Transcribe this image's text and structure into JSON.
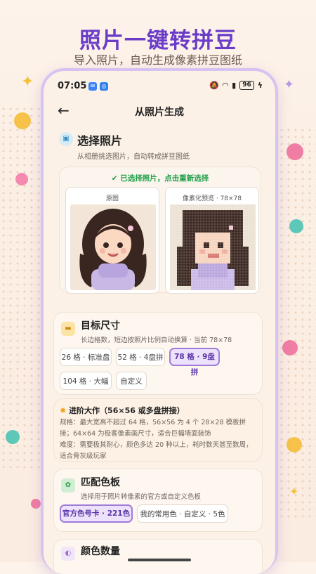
{
  "promo": {
    "title": "照片一键转拼豆",
    "subtitle": "导入照片，自动生成像素拼豆图纸"
  },
  "status_bar": {
    "time": "07:05",
    "battery": "96"
  },
  "nav": {
    "title": "从照片生成"
  },
  "select_photo": {
    "title": "选择照片",
    "desc": "从相册挑选图片，自动转成拼豆图纸",
    "selected_notice": "已选择照片，点击重新选择",
    "original_caption": "原图",
    "preview_caption": "像素化预览 · 78×78"
  },
  "target_size": {
    "title": "目标尺寸",
    "desc": "长边格数，短边按照片比例自动换算 · 当前 78×78",
    "options": [
      "26 格 · 标准盘",
      "52 格 · 4盘拼",
      "78 格 · 9盘拼",
      "104 格 · 大幅",
      "自定义"
    ],
    "selected": "78 格 · 9盘拼"
  },
  "advanced": {
    "title": "进阶大作（56×56 或多盘拼接）",
    "spec": "规格：最大宽高不超过 64 格，56×56 为 4 个 28×28 模板拼接；64×64 为极客像素画尺寸，适合巨幅墙面装饰",
    "difficulty": "难度：需要极其耐心，颜色多达 20 种以上，耗时数天甚至数周，适合骨灰级玩家"
  },
  "palette": {
    "title": "匹配色板",
    "desc": "选择用于照片转像素的官方或自定义色板",
    "options": [
      "官方色号卡 · 221色",
      "我的常用色 · 自定义 · 5色"
    ],
    "selected": "官方色号卡 · 221色"
  },
  "color_count": {
    "title": "颜色数量"
  },
  "colors": {
    "accent": "#6a3cc8",
    "selected_bg": "#ede2fb",
    "selected_border": "#a07cd8",
    "success": "#22a04a",
    "background": "#fbf1e6"
  }
}
